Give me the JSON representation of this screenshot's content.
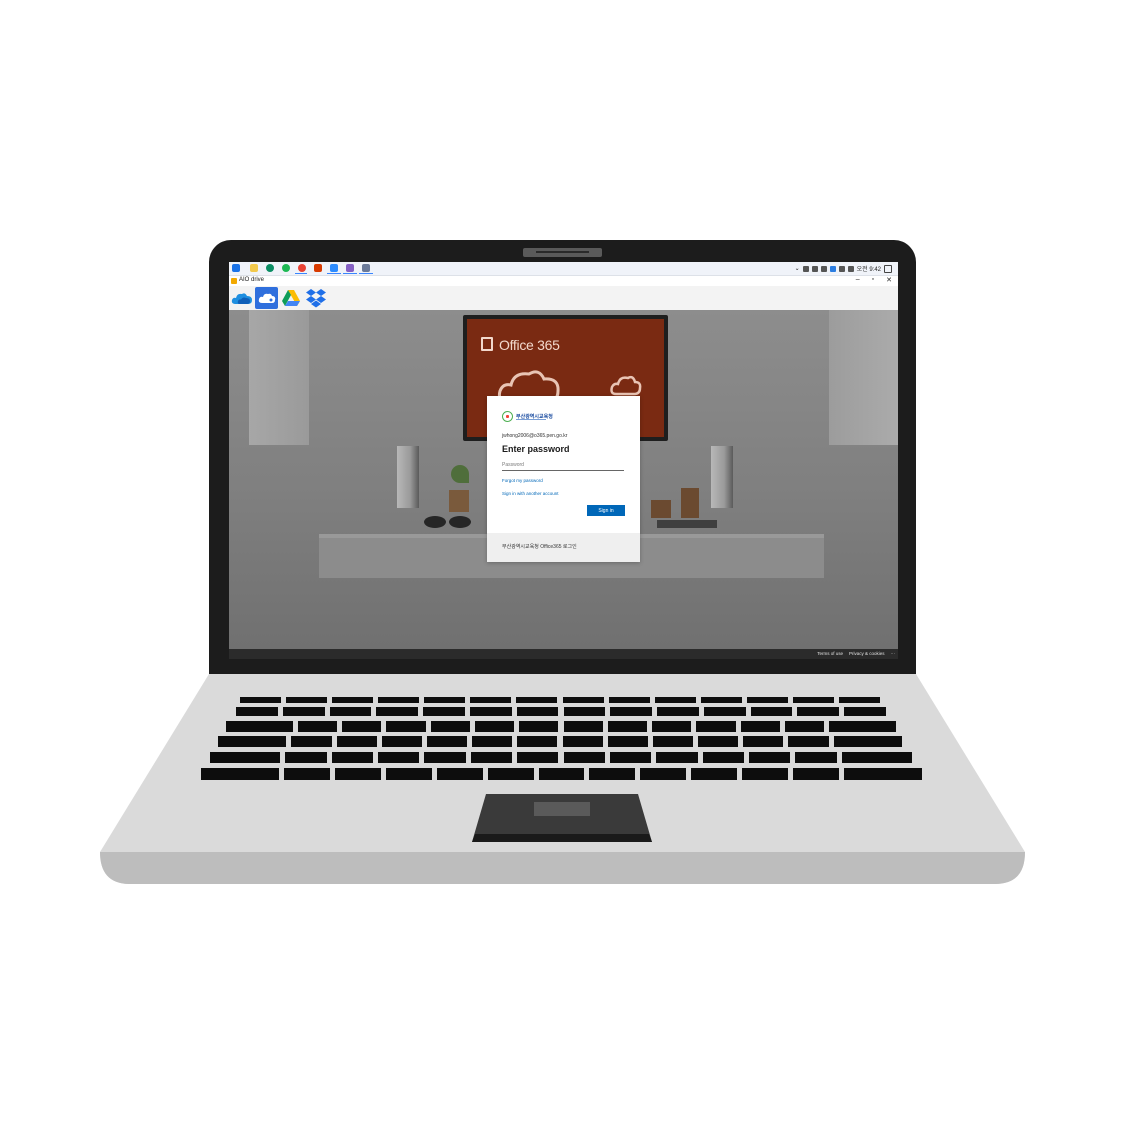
{
  "taskbar": {
    "clock": "오전 9:42",
    "pinned_apps": [
      {
        "icon": "windows-start-icon",
        "color": "#1a73e8"
      },
      {
        "icon": "file-explorer-icon",
        "color": "#f2c94c"
      },
      {
        "icon": "edge-icon",
        "color": "#0a8d63"
      },
      {
        "icon": "spotify-icon",
        "color": "#1db954"
      },
      {
        "icon": "chrome-icon",
        "color": "#e94235"
      },
      {
        "icon": "office-icon",
        "color": "#d83b01"
      },
      {
        "icon": "zoom-icon",
        "color": "#2d8cff"
      },
      {
        "icon": "visual-studio-icon",
        "color": "#8661c5"
      },
      {
        "icon": "aio-drive-icon",
        "color": "#6b7a99"
      }
    ]
  },
  "app": {
    "title": "AIO drive",
    "minimize": "–",
    "maximize": "▫",
    "close": "✕"
  },
  "drives": [
    {
      "icon": "onedrive-icon",
      "active": false
    },
    {
      "icon": "cloud-drive-icon",
      "active": true
    },
    {
      "icon": "google-drive-icon",
      "active": false
    },
    {
      "icon": "dropbox-icon",
      "active": false
    }
  ],
  "background": {
    "tv_text": "Office 365"
  },
  "signin": {
    "org_name": "부산광역시교육청",
    "email": "jwhong2006@o365.pen.go.kr",
    "title": "Enter password",
    "password_placeholder": "Password",
    "forgot_link": "Forgot my password",
    "other_account_link": "Sign in with another account",
    "signin_button": "Sign in",
    "footer_text": "부산광역시교육청 Office365 로그인"
  },
  "page_footer": {
    "terms": "Terms of use",
    "privacy": "Privacy & cookies",
    "more": "···"
  },
  "colors": {
    "accent": "#0067b8",
    "laptop_body": "#dadada",
    "laptop_bezel": "#1c1c1c"
  }
}
